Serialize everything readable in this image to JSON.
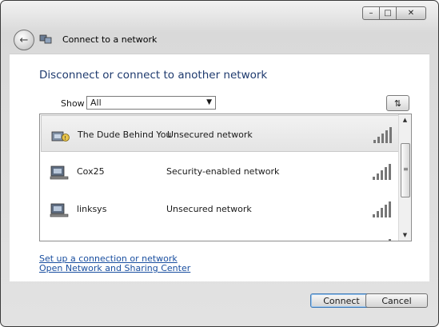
{
  "window": {
    "title": "Connect to a network",
    "controls": {
      "minimize": "–",
      "maximize": "□",
      "close": "✕"
    }
  },
  "heading": "Disconnect or connect to another network",
  "filter": {
    "label": "Show",
    "selected": "All"
  },
  "networks": [
    {
      "name": "The Dude Behind You",
      "security": "Unsecured network",
      "icon": "unsecured-network-icon",
      "signal": 5
    },
    {
      "name": "Cox25",
      "security": "Security-enabled network",
      "icon": "secured-network-icon",
      "signal": 5
    },
    {
      "name": "linksys",
      "security": "Unsecured network",
      "icon": "unsecured-network-icon",
      "signal": 5
    }
  ],
  "links": {
    "setup": "Set up a connection or network",
    "sharing_center": "Open Network and Sharing Center"
  },
  "buttons": {
    "connect": "Connect",
    "cancel": "Cancel"
  }
}
